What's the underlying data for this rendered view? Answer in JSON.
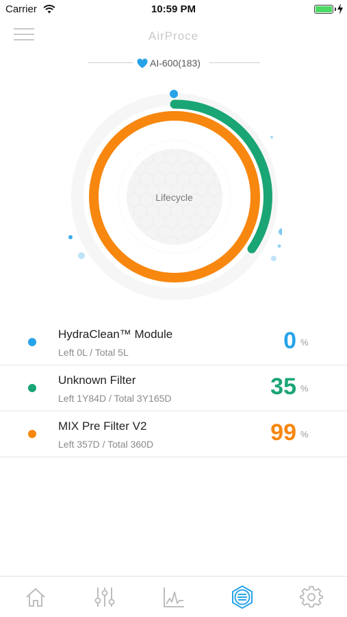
{
  "status_bar": {
    "carrier": "Carrier",
    "time": "10:59 PM"
  },
  "nav": {
    "title": "AirProce",
    "device": "AI-600(183)"
  },
  "gauge": {
    "center_label": "Lifecycle"
  },
  "filters": [
    {
      "name": "HydraClean™ Module",
      "detail": "Left 0L / Total 5L",
      "percent": "0",
      "unit": "%",
      "color": "#27a3e8"
    },
    {
      "name": "Unknown Filter",
      "detail": "Left 1Y84D / Total 3Y165D",
      "percent": "35",
      "unit": "%",
      "color": "#1aa575"
    },
    {
      "name": "MIX Pre Filter V2",
      "detail": "Left 357D / Total 360D",
      "percent": "99",
      "unit": "%",
      "color": "#f7870f"
    }
  ],
  "tabs": [
    {
      "icon": "home-icon"
    },
    {
      "icon": "sliders-icon"
    },
    {
      "icon": "chart-icon"
    },
    {
      "icon": "filter-icon",
      "active": true
    },
    {
      "icon": "gear-icon"
    }
  ],
  "colors": {
    "accent_blue": "#27a3e8",
    "green": "#1aa575",
    "orange": "#f7870f",
    "inactive_icon": "#bdbdbd"
  }
}
